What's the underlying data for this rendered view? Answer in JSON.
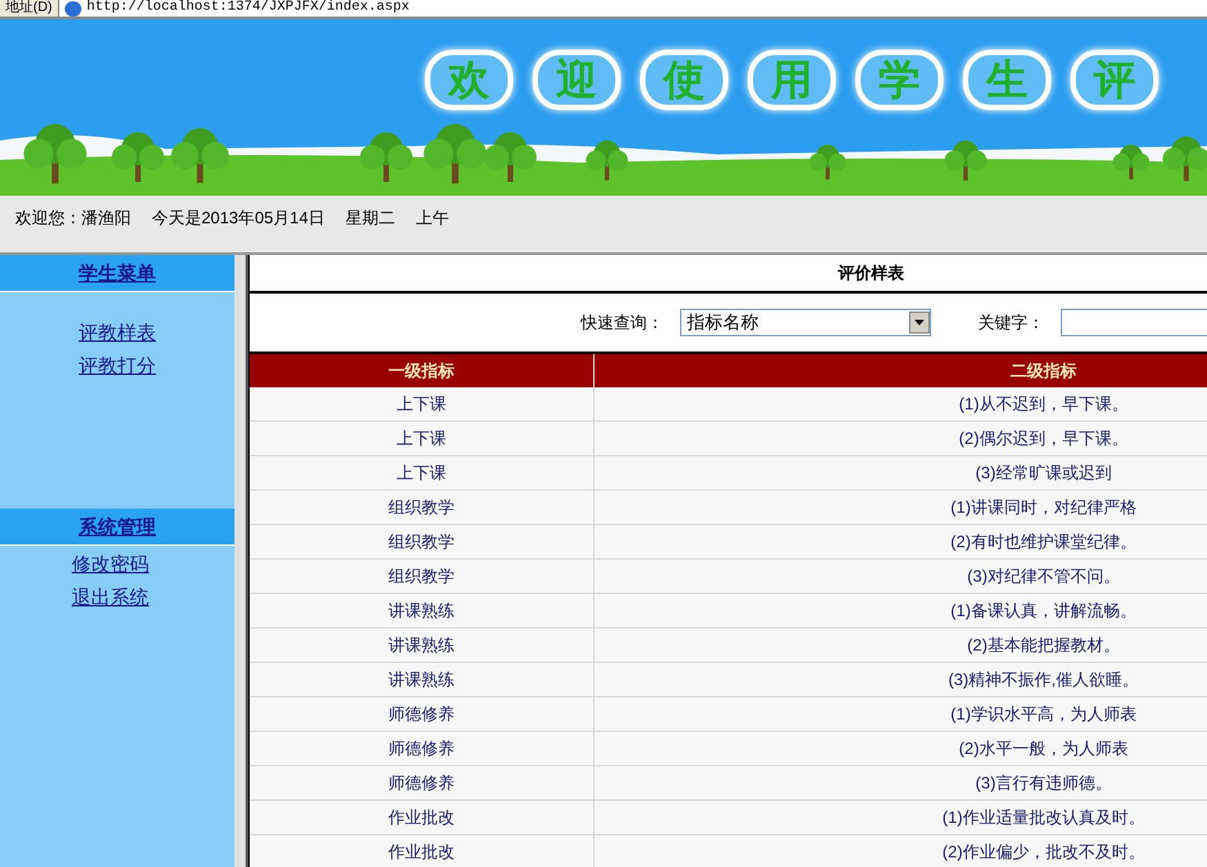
{
  "address_bar": {
    "label": "地址(D)",
    "url": "http://localhost:1374/JXPJFX/index.aspx"
  },
  "banner": {
    "title_chars": [
      "欢",
      "迎",
      "使",
      "用",
      "学",
      "生",
      "评"
    ]
  },
  "welcome_bar": {
    "user": "欢迎您：潘渔阳",
    "date": "今天是2013年05月14日",
    "weekday": "星期二",
    "period": "上午"
  },
  "sidebar": {
    "sections": [
      {
        "title": "学生菜单",
        "items": [
          {
            "label": "评教样表"
          },
          {
            "label": "评教打分"
          }
        ]
      },
      {
        "title": "系统管理",
        "items": [
          {
            "label": "修改密码"
          },
          {
            "label": "退出系统"
          }
        ]
      }
    ]
  },
  "main": {
    "title": "评价样表",
    "search": {
      "label": "快速查询：",
      "select_value": "指标名称",
      "keyword_label": "关键字："
    },
    "table": {
      "columns": [
        "一级指标",
        "二级指标"
      ],
      "rows": [
        [
          "上下课",
          "(1)从不迟到，早下课。"
        ],
        [
          "上下课",
          "(2)偶尔迟到，早下课。"
        ],
        [
          "上下课",
          "(3)经常旷课或迟到"
        ],
        [
          "组织教学",
          "(1)讲课同时，对纪律严格"
        ],
        [
          "组织教学",
          "(2)有时也维护课堂纪律。"
        ],
        [
          "组织教学",
          "(3)对纪律不管不问。"
        ],
        [
          "讲课熟练",
          "(1)备课认真，讲解流畅。"
        ],
        [
          "讲课熟练",
          "(2)基本能把握教材。"
        ],
        [
          "讲课熟练",
          "(3)精神不振作,催人欲睡。"
        ],
        [
          "师德修养",
          "(1)学识水平高，为人师表"
        ],
        [
          "师德修养",
          "(2)水平一般，为人师表"
        ],
        [
          "师德修养",
          "(3)言行有违师德。"
        ],
        [
          "作业批改",
          "(1)作业适量批改认真及时。"
        ],
        [
          "作业批改",
          "(2)作业偏少，批改不及时。"
        ]
      ]
    }
  }
}
